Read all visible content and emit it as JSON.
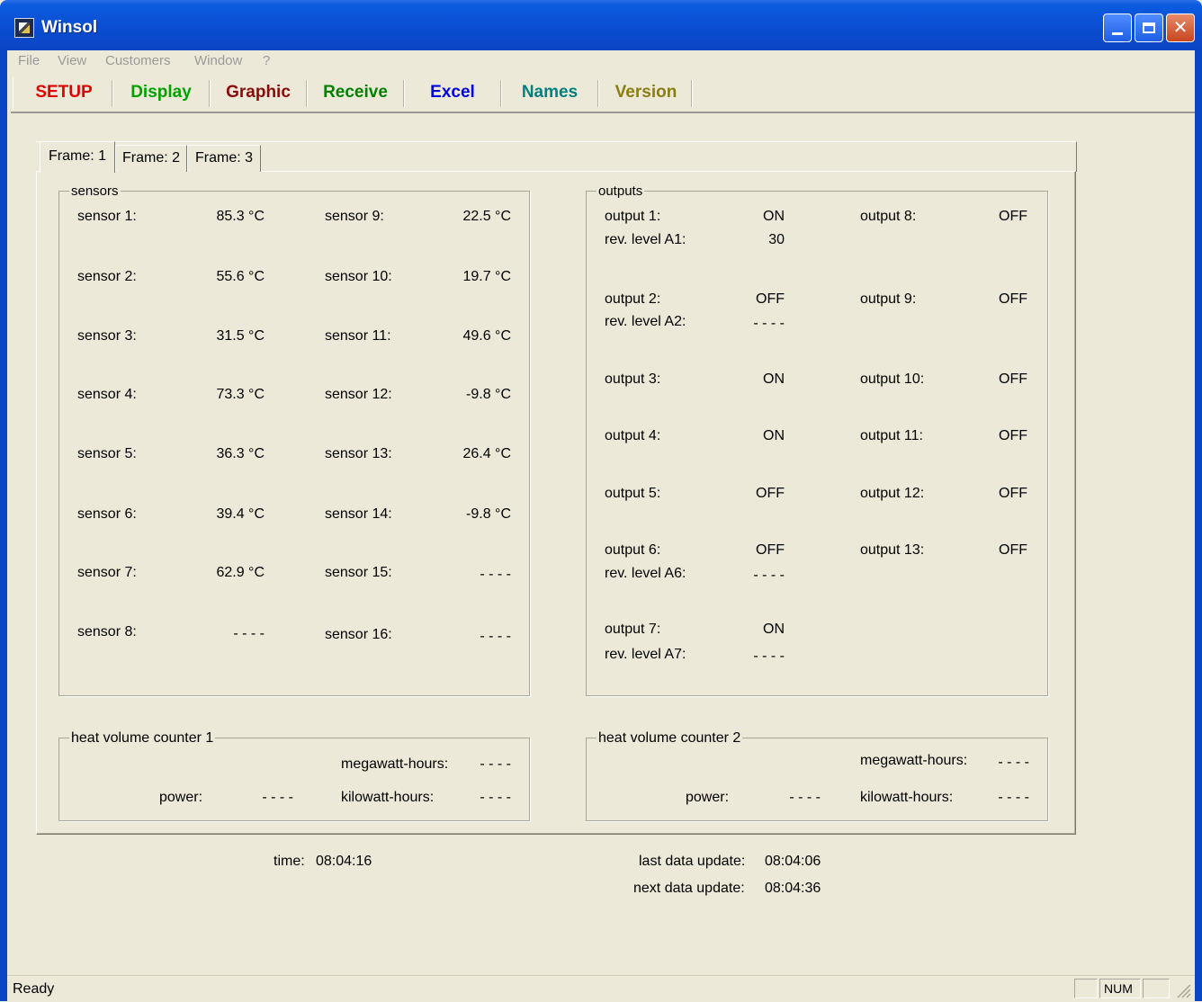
{
  "window": {
    "title": "Winsol",
    "minimize": "_",
    "maximize": "□",
    "close": "✕"
  },
  "menu": [
    "File",
    "View",
    "Customers",
    "Window",
    "?"
  ],
  "toolbar": [
    {
      "label": "SETUP",
      "color": "#E00000"
    },
    {
      "label": "Display",
      "color": "#00A000"
    },
    {
      "label": "Graphic",
      "color": "#8B0A0A"
    },
    {
      "label": "Receive",
      "color": "#008000"
    },
    {
      "label": "Excel",
      "color": "#0000E0"
    },
    {
      "label": "Names",
      "color": "#008080"
    },
    {
      "label": "Version",
      "color": "#8B7D10"
    }
  ],
  "tabs": [
    "Frame: 1",
    "Frame: 2",
    "Frame: 3"
  ],
  "sensors": {
    "title": "sensors",
    "left": [
      {
        "label": "sensor 1:",
        "value": "85.3 °C"
      },
      {
        "label": "sensor 2:",
        "value": "55.6 °C"
      },
      {
        "label": "sensor 3:",
        "value": "31.5 °C"
      },
      {
        "label": "sensor 4:",
        "value": "73.3 °C"
      },
      {
        "label": "sensor 5:",
        "value": "36.3 °C"
      },
      {
        "label": "sensor 6:",
        "value": "39.4 °C"
      },
      {
        "label": "sensor 7:",
        "value": "62.9 °C"
      },
      {
        "label": "sensor 8:",
        "value": "- - - -"
      }
    ],
    "right": [
      {
        "label": "sensor 9:",
        "value": "22.5 °C"
      },
      {
        "label": "sensor 10:",
        "value": "19.7 °C"
      },
      {
        "label": "sensor 11:",
        "value": "49.6 °C"
      },
      {
        "label": "sensor 12:",
        "value": "-9.8 °C"
      },
      {
        "label": "sensor 13:",
        "value": "26.4 °C"
      },
      {
        "label": "sensor 14:",
        "value": "-9.8 °C"
      },
      {
        "label": "sensor 15:",
        "value": "- - - -"
      },
      {
        "label": "sensor 16:",
        "value": "- - - -"
      }
    ]
  },
  "outputs": {
    "title": "outputs",
    "left": [
      {
        "label": "output 1:",
        "value": "ON",
        "rev_label": "rev. level A1:",
        "rev_value": "30"
      },
      {
        "label": "output 2:",
        "value": "OFF",
        "rev_label": "rev. level A2:",
        "rev_value": "- - - -"
      },
      {
        "label": "output 3:",
        "value": "ON"
      },
      {
        "label": "output 4:",
        "value": "ON"
      },
      {
        "label": "output 5:",
        "value": "OFF"
      },
      {
        "label": "output 6:",
        "value": "OFF",
        "rev_label": "rev. level A6:",
        "rev_value": "- - - -"
      },
      {
        "label": "output 7:",
        "value": "ON",
        "rev_label": "rev. level A7:",
        "rev_value": "- - - -"
      }
    ],
    "right": [
      {
        "label": "output 8:",
        "value": "OFF"
      },
      {
        "label": "output 9:",
        "value": "OFF"
      },
      {
        "label": "output 10:",
        "value": "OFF"
      },
      {
        "label": "output 11:",
        "value": "OFF"
      },
      {
        "label": "output 12:",
        "value": "OFF"
      },
      {
        "label": "output 13:",
        "value": "OFF"
      }
    ]
  },
  "heat1": {
    "title": "heat volume counter 1",
    "megawatt_label": "megawatt-hours:",
    "megawatt_value": "- - - -",
    "power_label": "power:",
    "power_value": "- - - -",
    "kilowatt_label": "kilowatt-hours:",
    "kilowatt_value": "- - - -"
  },
  "heat2": {
    "title": "heat volume counter 2",
    "megawatt_label": "megawatt-hours:",
    "megawatt_value": "- - - -",
    "power_label": "power:",
    "power_value": "- - - -",
    "kilowatt_label": "kilowatt-hours:",
    "kilowatt_value": "- - - -"
  },
  "time": {
    "label": "time:",
    "value": "08:04:16"
  },
  "last_update": {
    "label": "last data update:",
    "value": "08:04:06"
  },
  "next_update": {
    "label": "next data update:",
    "value": "08:04:36"
  },
  "status": {
    "text": "Ready",
    "num": "NUM"
  }
}
